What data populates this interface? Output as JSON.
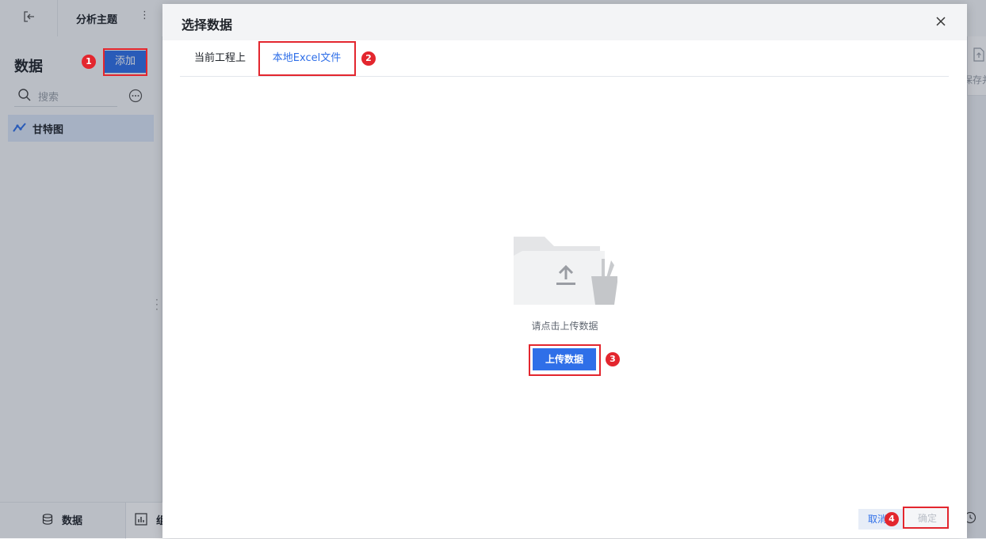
{
  "topbar": {
    "title": "分析主题",
    "more_glyph": "⋮",
    "exit_icon": "exit-icon"
  },
  "sidebar": {
    "title": "数据",
    "add_label": "添加",
    "search_placeholder": "搜索",
    "items": [
      {
        "label": "甘特图",
        "icon": "line-chart-icon"
      }
    ]
  },
  "bottombar": {
    "data_tab_label": "数据",
    "component_tab_label": "组"
  },
  "right_stub": {
    "label": "保存并"
  },
  "modal": {
    "title": "选择数据",
    "tabs": [
      {
        "label": "当前工程上"
      },
      {
        "label": "本地Excel文件",
        "active": true
      }
    ],
    "empty_text": "请点击上传数据",
    "upload_label": "上传数据",
    "cancel_label": "取消",
    "ok_label": "确定"
  },
  "annotations": [
    "1",
    "2",
    "3",
    "4"
  ],
  "colors": {
    "accent": "#2f6fe8",
    "highlight": "#e3262e",
    "sidebar_item_bg": "#dbe6f7"
  }
}
